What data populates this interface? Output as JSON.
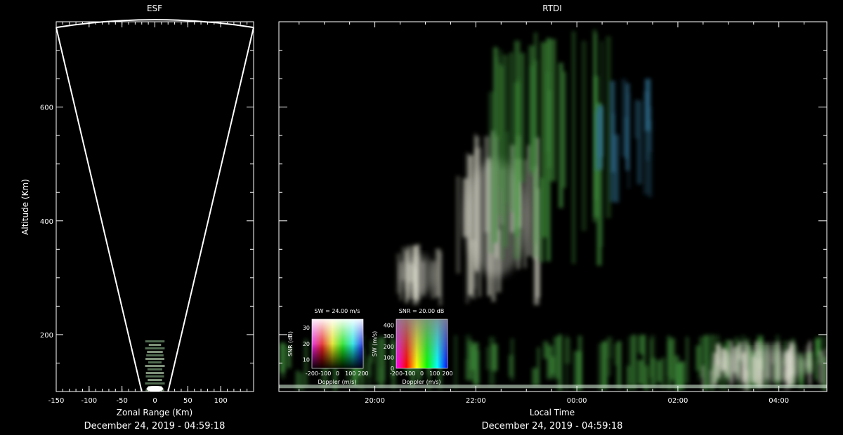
{
  "colors": {
    "background": "#000000",
    "foreground": "#ffffff"
  },
  "chart_data": [
    {
      "type": "heatmap",
      "title": "ESF",
      "xlabel": "Zonal Range (Km)",
      "ylabel": "Altitude (Km)",
      "xlim": [
        -150,
        150
      ],
      "ylim": [
        100,
        750
      ],
      "x_ticks": [
        "-150",
        "-100",
        "-50",
        "0",
        "50",
        "100"
      ],
      "x_tick_values": [
        -150,
        -100,
        -50,
        0,
        50,
        100
      ],
      "y_ticks": [
        "200",
        "400",
        "600"
      ],
      "y_tick_values": [
        200,
        400,
        600
      ],
      "beam_edges": [
        {
          "label": "left",
          "points": [
            [
              -150,
              740
            ],
            [
              -20,
              100
            ]
          ]
        },
        {
          "label": "right",
          "points": [
            [
              150,
              740
            ],
            [
              20,
              100
            ]
          ]
        }
      ],
      "echo_region": {
        "x": [
          -15,
          15
        ],
        "y": [
          100,
          190
        ]
      },
      "date": "December 24, 2019 - 04:59:18"
    },
    {
      "type": "heatmap",
      "title": "RTDI",
      "xlabel": "Local Time",
      "ylabel": "",
      "x_ticks": [
        "20:00",
        "22:00",
        "00:00",
        "02:00",
        "04:00"
      ],
      "x_tick_hours": [
        20,
        22,
        24,
        26,
        28
      ],
      "xlim_hours": [
        18.1,
        28.95
      ],
      "ylim": [
        100,
        750
      ],
      "y_tick_values": [
        200,
        400,
        600
      ],
      "echo_regions": [
        {
          "t": [
            21.6,
            23.2
          ],
          "alt": [
            250,
            560
          ],
          "tone": "white"
        },
        {
          "t": [
            22.2,
            24.6
          ],
          "alt": [
            320,
            740
          ],
          "tone": "green"
        },
        {
          "t": [
            24.3,
            25.5
          ],
          "alt": [
            430,
            650
          ],
          "tone": "blue"
        },
        {
          "t": [
            20.4,
            21.3
          ],
          "alt": [
            250,
            360
          ],
          "tone": "white"
        },
        {
          "t": [
            18.1,
            28.95
          ],
          "alt": [
            100,
            200
          ],
          "tone": "green"
        },
        {
          "t": [
            26.4,
            28.95
          ],
          "alt": [
            100,
            190
          ],
          "tone": "white"
        }
      ],
      "legends": [
        {
          "title": "SW = 24.00 m/s",
          "xlabel": "Doppler (m/s)",
          "ylabel": "SNR (dB)",
          "x_ticks": [
            "-200",
            "-100",
            "0",
            "100",
            "200"
          ],
          "y_ticks": [
            "10",
            "20",
            "30"
          ]
        },
        {
          "title": "SNR = 20.00 dB",
          "xlabel": "Doppler (m/s)",
          "ylabel": "SW (m/s)",
          "x_ticks": [
            "-200",
            "-100",
            "0",
            "100",
            "200"
          ],
          "y_ticks": [
            "0",
            "100",
            "200",
            "300",
            "400"
          ]
        }
      ],
      "date": "December 24, 2019 - 04:59:18"
    }
  ]
}
